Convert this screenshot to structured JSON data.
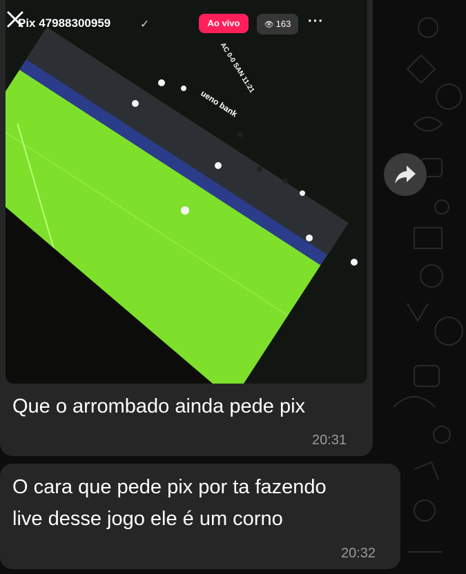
{
  "live": {
    "username": "Pix 47988300959",
    "check_icon": "check-icon",
    "badge": "Ao vivo",
    "viewers": "163",
    "eye_icon": "eye-icon",
    "more": "···"
  },
  "video_overlay": {
    "scoreboard_team_left": "AC",
    "scoreboard_score": "0-0",
    "scoreboard_team_right": "SAN",
    "scoreboard_clock": "11:21",
    "ad_text": "ueno bank"
  },
  "messages": [
    {
      "text": "Que o arrombado ainda pede pix",
      "time": "20:31"
    },
    {
      "text_line1": "O cara que pede pix por ta fazendo",
      "text_line2": "live desse jogo ele é um corno",
      "time": "20:32"
    }
  ],
  "forward_icon": "forward-icon",
  "colors": {
    "bubble": "#262626",
    "chat_background": "#0d0d0d",
    "live_badge": "#ff1f5a",
    "pitch_green": "#7fe02c",
    "timestamp": "#9a9a9a"
  }
}
